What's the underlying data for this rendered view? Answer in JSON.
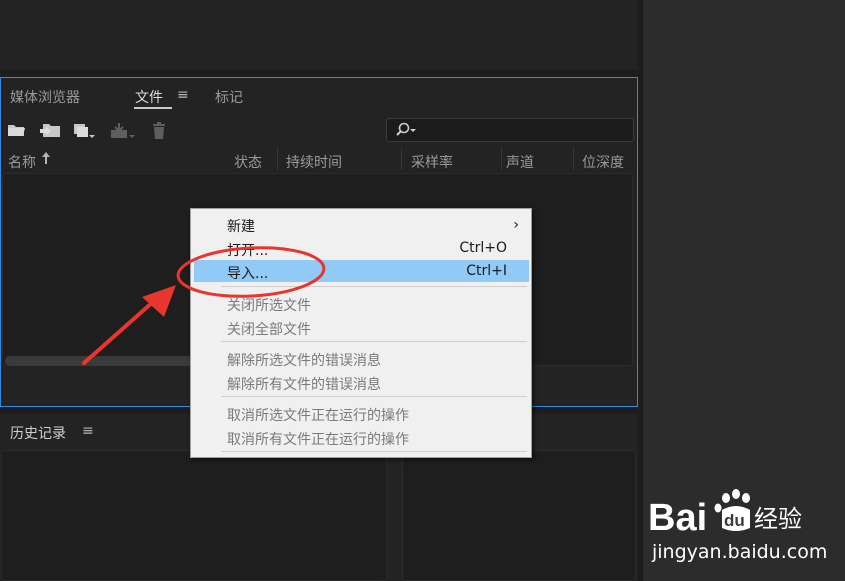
{
  "files_panel": {
    "tabs": [
      {
        "label": "媒体浏览器"
      },
      {
        "label": "文件"
      },
      {
        "label": "标记"
      }
    ],
    "menu_glyph": "≡",
    "columns": [
      "名称",
      "状态",
      "持续时间",
      "采样率",
      "声道",
      "位深度"
    ],
    "sort_indicator": "sort-ascending-arrow-icon",
    "search": {
      "placeholder": "",
      "value": ""
    },
    "toolbar_icons": [
      "open-folder-icon",
      "import-media-icon",
      "new-item-icon",
      "export-icon",
      "delete-icon"
    ]
  },
  "history_panel": {
    "title": "历史记录",
    "menu_glyph": "≡"
  },
  "context_menu": {
    "items": [
      {
        "label": "新建",
        "shortcut": "",
        "has_submenu": true,
        "enabled": true
      },
      {
        "label": "打开...",
        "shortcut": "Ctrl+O",
        "enabled": true
      },
      {
        "label": "导入...",
        "shortcut": "Ctrl+I",
        "enabled": true,
        "highlighted": true
      },
      {
        "label": "关闭所选文件",
        "shortcut": "",
        "enabled": false
      },
      {
        "label": "关闭全部文件",
        "shortcut": "",
        "enabled": false
      },
      {
        "label": "解除所选文件的错误消息",
        "shortcut": "",
        "enabled": false
      },
      {
        "label": "解除所有文件的错误消息",
        "shortcut": "",
        "enabled": false
      },
      {
        "label": "取消所选文件正在运行的操作",
        "shortcut": "",
        "enabled": false
      },
      {
        "label": "取消所有文件正在运行的操作",
        "shortcut": "",
        "enabled": false
      }
    ],
    "submenu_glyph": "›"
  },
  "annotation": {
    "color": "#e8352d"
  },
  "watermark": {
    "brand_prefix": "Bai",
    "brand_suffix": "du",
    "product": "经验",
    "url": "jingyan.baidu.com"
  },
  "colors": {
    "focus_border": "#2d8ceb",
    "menu_highlight": "#91c9f7",
    "panel_bg": "#232323"
  }
}
